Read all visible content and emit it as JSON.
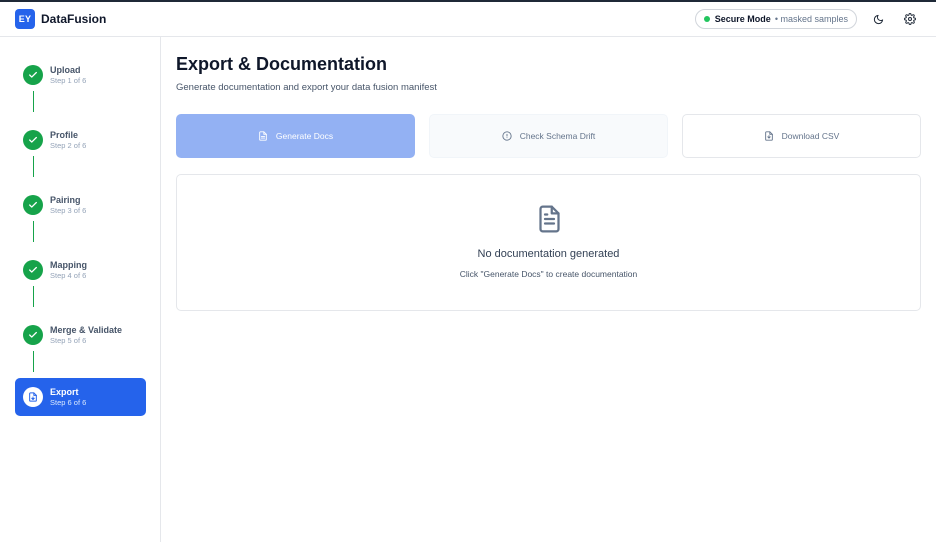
{
  "app": {
    "logo_text": "EY",
    "title": "DataFusion"
  },
  "header": {
    "secure_title": "Secure Mode",
    "secure_sub": "• masked samples",
    "icons": [
      "moon-icon",
      "gear-icon"
    ]
  },
  "steps": [
    {
      "label": "Upload",
      "sub": "Step 1 of 6",
      "status": "complete"
    },
    {
      "label": "Profile",
      "sub": "Step 2 of 6",
      "status": "complete"
    },
    {
      "label": "Pairing",
      "sub": "Step 3 of 6",
      "status": "complete"
    },
    {
      "label": "Mapping",
      "sub": "Step 4 of 6",
      "status": "complete"
    },
    {
      "label": "Merge & Validate",
      "sub": "Step 5 of 6",
      "status": "complete"
    },
    {
      "label": "Export",
      "sub": "Step 6 of 6",
      "status": "active"
    }
  ],
  "main": {
    "title": "Export & Documentation",
    "subtitle": "Generate documentation and export your data fusion manifest",
    "buttons": {
      "generate_docs": "Generate Docs",
      "check_drift": "Check Schema Drift",
      "download_csv": "Download CSV"
    },
    "empty_state": {
      "title": "No documentation generated",
      "hint": "Click \"Generate Docs\" to create documentation"
    }
  },
  "colors": {
    "primary": "#2563eb",
    "primary_disabled": "#93b1f3",
    "success": "#16a34a",
    "secure_dot": "#22c55e"
  }
}
